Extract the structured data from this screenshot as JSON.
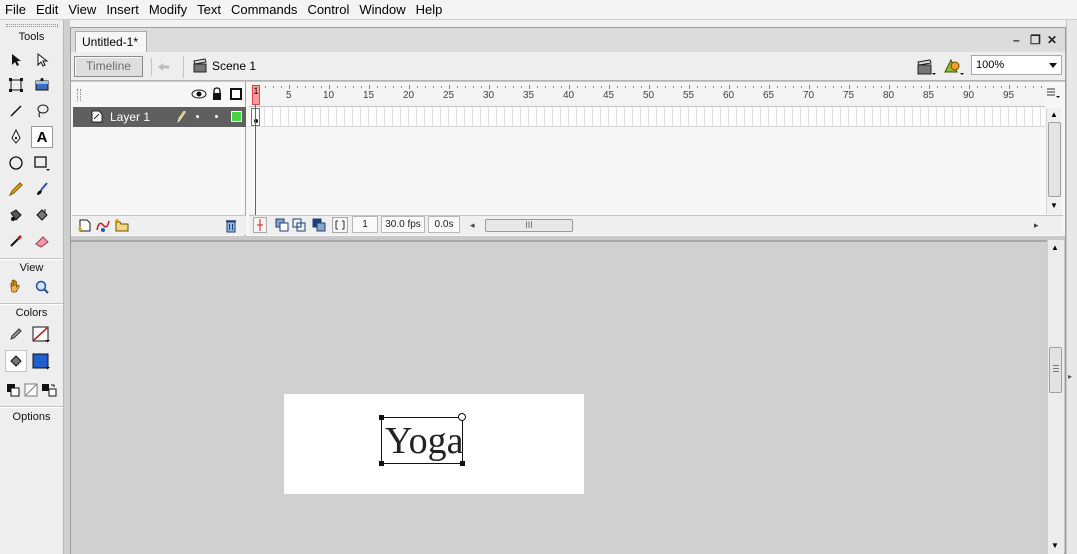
{
  "menubar": {
    "items": [
      "File",
      "Edit",
      "View",
      "Insert",
      "Modify",
      "Text",
      "Commands",
      "Control",
      "Window",
      "Help"
    ]
  },
  "tools_panel": {
    "tools_heading": "Tools",
    "view_heading": "View",
    "colors_heading": "Colors",
    "options_heading": "Options",
    "stroke_color": "#cc0000",
    "fill_color": "#1f5fd0"
  },
  "document": {
    "tab_label": "Untitled-1*",
    "window_controls": [
      "–",
      "❐",
      "✕"
    ]
  },
  "edit_bar": {
    "timeline_button": "Timeline",
    "scene_label": "Scene 1",
    "zoom_value": "100%"
  },
  "timeline": {
    "layer_name": "Layer 1",
    "ruler_labels": [
      "1",
      "5",
      "10",
      "15",
      "20",
      "25",
      "30",
      "35",
      "40",
      "45",
      "50",
      "55",
      "60",
      "65",
      "70",
      "75",
      "80",
      "85",
      "90",
      "95"
    ],
    "current_frame": "1",
    "frame_rate": "30.0 fps",
    "elapsed_time": "0.0s",
    "scroll_thumb_grip": "III"
  },
  "stage": {
    "text": "Yoga"
  }
}
